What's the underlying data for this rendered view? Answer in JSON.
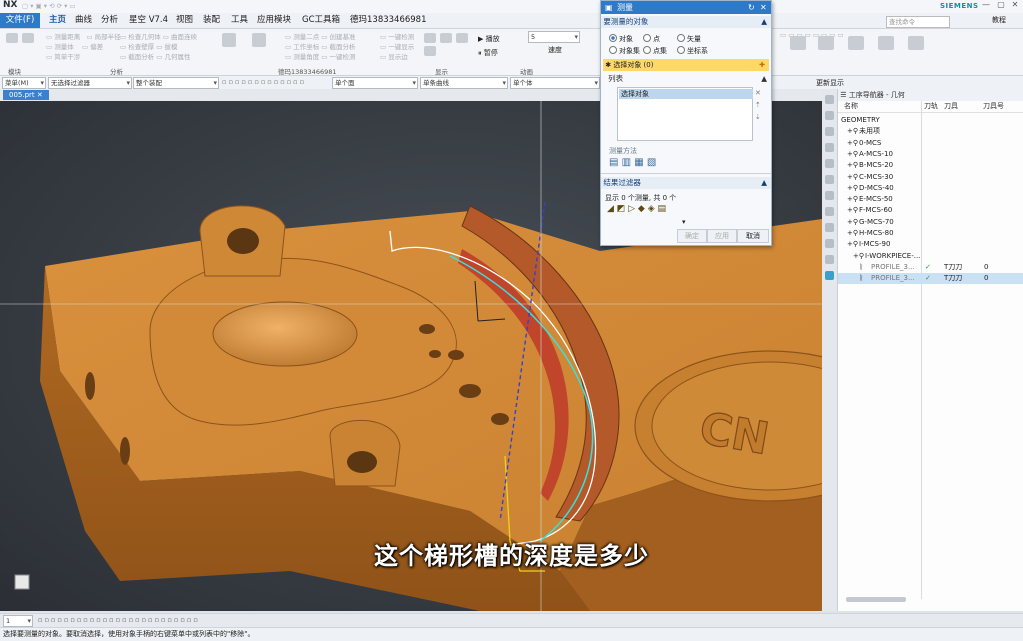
{
  "titlebar": {
    "app": "NX",
    "brand": "SIEMENS",
    "search_placeholder": "查找命令"
  },
  "menu": {
    "file": "文件(F)",
    "items": [
      "主页",
      "曲线",
      "分析",
      "星空 V7.4",
      "视图",
      "装配",
      "工具",
      "应用模块",
      "GC工具箱",
      "德玛13833466981"
    ],
    "help": "教程"
  },
  "ribbon": {
    "groups": [
      "模块",
      "分析",
      "德玛13833466981",
      "显示",
      "动画"
    ],
    "playback": {
      "play": "播放",
      "pause": "暂停",
      "speed_label": "速度",
      "speed_value": "5"
    }
  },
  "filterbar": {
    "menu": "菜单(M)",
    "filter": "无选择过滤器",
    "assembly": "整个装配",
    "face": "单个面",
    "curve": "单条曲线",
    "body": "单个体",
    "display": "更新显示"
  },
  "doc_tab": {
    "file": "005.prt"
  },
  "dialog": {
    "title": "测量",
    "section_objects": "要测量的对象",
    "radios": [
      {
        "label": "对象",
        "on": true
      },
      {
        "label": "点",
        "on": false
      },
      {
        "label": "矢量",
        "on": false
      },
      {
        "label": "对象集",
        "on": false
      },
      {
        "label": "点集",
        "on": false
      },
      {
        "label": "坐标系",
        "on": false
      }
    ],
    "select_row": "选择对象 (0)",
    "list_label": "列表",
    "list_item": "选择对象",
    "method_label": "测量方法",
    "section_filter": "结果过滤器",
    "filter_info": "显示 0 个测量, 共 0 个",
    "buttons": {
      "ok": "确定",
      "apply": "应用",
      "cancel": "取消"
    }
  },
  "navigator": {
    "title": "工序导航器 - 几何",
    "columns": [
      "名称",
      "刀轨",
      "刀具",
      "刀具号"
    ],
    "rows": [
      {
        "name": "GEOMETRY",
        "indent": 0,
        "tool": "",
        "toolno": ""
      },
      {
        "name": "未用项",
        "indent": 1,
        "tool": "",
        "toolno": ""
      },
      {
        "name": "0-MCS",
        "indent": 1,
        "tool": "",
        "toolno": ""
      },
      {
        "name": "A-MCS-10",
        "indent": 1,
        "tool": "",
        "toolno": ""
      },
      {
        "name": "B-MCS-20",
        "indent": 1,
        "tool": "",
        "toolno": ""
      },
      {
        "name": "C-MCS-30",
        "indent": 1,
        "tool": "",
        "toolno": ""
      },
      {
        "name": "D-MCS-40",
        "indent": 1,
        "tool": "",
        "toolno": ""
      },
      {
        "name": "E-MCS-50",
        "indent": 1,
        "tool": "",
        "toolno": ""
      },
      {
        "name": "F-MCS-60",
        "indent": 1,
        "tool": "",
        "toolno": ""
      },
      {
        "name": "G-MCS-70",
        "indent": 1,
        "tool": "",
        "toolno": ""
      },
      {
        "name": "H-MCS-80",
        "indent": 1,
        "tool": "",
        "toolno": ""
      },
      {
        "name": "I-MCS-90",
        "indent": 1,
        "tool": "",
        "toolno": ""
      },
      {
        "name": "I-WORKPIECE-...",
        "indent": 2,
        "tool": "",
        "toolno": ""
      },
      {
        "name": "PROFILE_3...",
        "indent": 3,
        "tool": "T刀刀",
        "toolno": "0"
      },
      {
        "name": "PROFILE_3...",
        "indent": 3,
        "tool": "T刀刀",
        "toolno": "0",
        "selected": true
      }
    ]
  },
  "viewport": {
    "engraved_text": "CN",
    "subtitle": "这个梯形槽的深度是多少"
  },
  "bottombar": {
    "page": "1"
  },
  "status": "选择要测量的对象。要取消选择，使用对象手柄的右键菜单中或列表中的\"移除\"。"
}
